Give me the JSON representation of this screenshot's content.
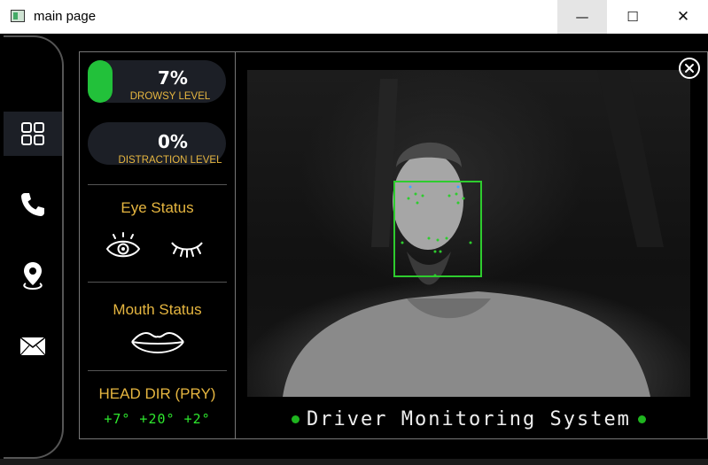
{
  "window": {
    "title": "main page",
    "minimize_glyph": "—",
    "maximize_glyph": "☐",
    "close_glyph": "✕"
  },
  "sidebar": {
    "items": [
      {
        "name": "dashboard",
        "icon": "grid-icon",
        "active": true
      },
      {
        "name": "call",
        "icon": "phone-icon",
        "active": false
      },
      {
        "name": "location",
        "icon": "location-pin-icon",
        "active": false
      },
      {
        "name": "message",
        "icon": "mail-icon",
        "active": false
      }
    ]
  },
  "drowsy": {
    "value": "7%",
    "label": "DROWSY LEVEL",
    "fill_percent": 7,
    "color": "#22c13a"
  },
  "distraction": {
    "value": "0%",
    "label": "DISTRACTION LEVEL",
    "fill_percent": 0
  },
  "eye_status": {
    "title": "Eye Status",
    "icons": [
      "eye-open-icon",
      "eye-closed-icon"
    ]
  },
  "mouth_status": {
    "title": "Mouth Status",
    "icons": [
      "lips-icon"
    ]
  },
  "head_dir": {
    "title": "HEAD DIR (PRY)",
    "values": "+7° +20° +2°"
  },
  "camera": {
    "face_box_color": "#2ecc2e"
  },
  "footer": {
    "title": "Driver Monitoring System",
    "dot_color": "#1fb51f"
  },
  "colors": {
    "accent": "#e6b640",
    "panel": "#1c1f26",
    "value_green": "#2ee82e"
  }
}
